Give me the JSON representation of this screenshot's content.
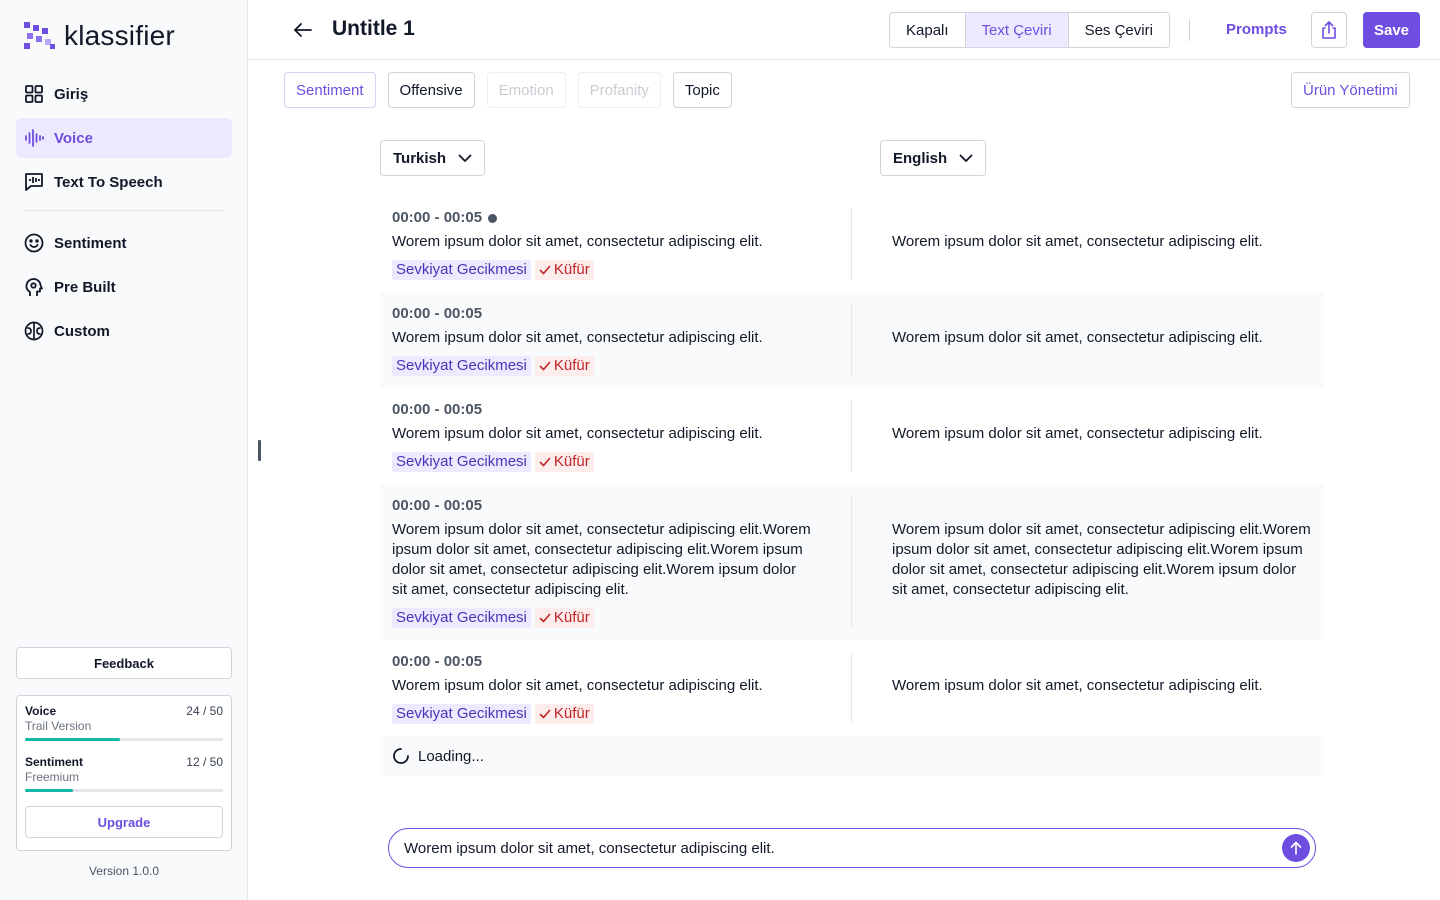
{
  "app": {
    "logo_text": "klassifier",
    "brand_color": "#6d4ee0"
  },
  "sidebar": {
    "items": [
      {
        "label": "Giriş",
        "icon": "grid-icon"
      },
      {
        "label": "Voice",
        "icon": "waveform-icon",
        "active": true
      },
      {
        "label": "Text To Speech",
        "icon": "speech-bubble-icon"
      },
      {
        "label": "Sentiment",
        "icon": "smile-icon"
      },
      {
        "label": "Pre Built",
        "icon": "head-gear-icon"
      },
      {
        "label": "Custom",
        "icon": "brain-icon"
      }
    ],
    "feedback_label": "Feedback",
    "usage": [
      {
        "name": "Voice",
        "count": "24 / 50",
        "plan": "Trail Version",
        "fraction": 0.48
      },
      {
        "name": "Sentiment",
        "count": "12 / 50",
        "plan": "Freemium",
        "fraction": 0.24
      }
    ],
    "upgrade_label": "Upgrade",
    "version": "Version 1.0.0"
  },
  "header": {
    "title": "Untitle 1",
    "modes": [
      "Kapalı",
      "Text Çeviri",
      "Ses Çeviri"
    ],
    "active_mode": "Text Çeviri",
    "prompts_label": "Prompts",
    "save_label": "Save"
  },
  "filters": {
    "chips": [
      {
        "label": "Sentiment",
        "state": "active"
      },
      {
        "label": "Offensive",
        "state": "normal"
      },
      {
        "label": "Emotion",
        "state": "disabled"
      },
      {
        "label": "Profanity",
        "state": "disabled"
      },
      {
        "label": "Topic",
        "state": "normal"
      }
    ],
    "product_management_label": "Ürün Yönetimi"
  },
  "languages": {
    "source": "Turkish",
    "target": "English"
  },
  "transcript": {
    "rows": [
      {
        "time": "00:00 - 00:05",
        "playing": true,
        "source": "Worem ipsum dolor sit amet, consectetur adipiscing elit.",
        "target": "Worem ipsum dolor sit amet, consectetur adipiscing elit.",
        "tag_topic": "Sevkiyat Gecikmesi",
        "tag_profanity": "Küfür"
      },
      {
        "time": "00:00 - 00:05",
        "playing": false,
        "source": "Worem ipsum dolor sit amet, consectetur adipiscing elit.",
        "target": "Worem ipsum dolor sit amet, consectetur adipiscing elit.",
        "tag_topic": "Sevkiyat Gecikmesi",
        "tag_profanity": "Küfür"
      },
      {
        "time": "00:00 - 00:05",
        "playing": false,
        "source": "Worem ipsum dolor sit amet, consectetur adipiscing elit.",
        "target": "Worem ipsum dolor sit amet, consectetur adipiscing elit.",
        "tag_topic": "Sevkiyat Gecikmesi",
        "tag_profanity": "Küfür"
      },
      {
        "time": "00:00 - 00:05",
        "playing": false,
        "source": "Worem ipsum dolor sit amet, consectetur adipiscing elit.Worem ipsum dolor sit amet, consectetur adipiscing elit.Worem ipsum dolor sit amet, consectetur adipiscing elit.Worem ipsum dolor sit amet, consectetur adipiscing elit.",
        "target": "Worem ipsum dolor sit amet, consectetur adipiscing elit.Worem ipsum dolor sit amet, consectetur adipiscing elit.Worem ipsum dolor sit amet, consectetur adipiscing elit.Worem ipsum dolor sit amet, consectetur adipiscing elit.",
        "tag_topic": "Sevkiyat Gecikmesi",
        "tag_profanity": "Küfür"
      },
      {
        "time": "00:00 - 00:05",
        "playing": false,
        "source": "Worem ipsum dolor sit amet, consectetur adipiscing elit.",
        "target": "Worem ipsum dolor sit amet, consectetur adipiscing elit.",
        "tag_topic": "Sevkiyat Gecikmesi",
        "tag_profanity": "Küfür"
      }
    ],
    "loading_label": "Loading..."
  },
  "composer": {
    "value": "Worem ipsum dolor sit amet, consectetur adipiscing elit."
  }
}
